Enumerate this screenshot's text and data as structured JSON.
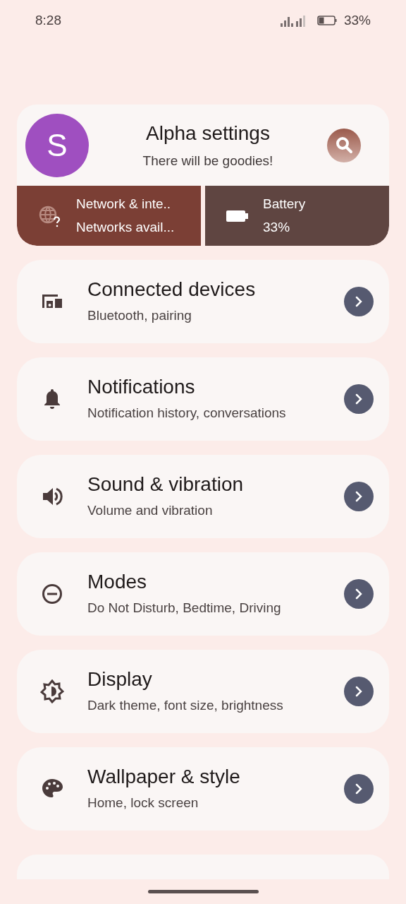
{
  "status_bar": {
    "time": "8:28",
    "battery": "33%"
  },
  "header": {
    "avatar": "S",
    "title": "Alpha settings",
    "subtitle": "There will be goodies!"
  },
  "tiles": [
    {
      "kind": "network",
      "title": "Network & inte..",
      "subtitle": "Networks avail..."
    },
    {
      "kind": "battery",
      "title": "Battery",
      "subtitle": "33%"
    }
  ],
  "items": [
    {
      "kind": "devices",
      "title": "Connected devices",
      "subtitle": "Bluetooth, pairing"
    },
    {
      "kind": "notifications",
      "title": "Notifications",
      "subtitle": "Notification history, conversations"
    },
    {
      "kind": "sound",
      "title": "Sound & vibration",
      "subtitle": "Volume and vibration"
    },
    {
      "kind": "modes",
      "title": "Modes",
      "subtitle": "Do Not Disturb, Bedtime, Driving"
    },
    {
      "kind": "display",
      "title": "Display",
      "subtitle": "Dark theme, font size, brightness"
    },
    {
      "kind": "wallpaper",
      "title": "Wallpaper & style",
      "subtitle": "Home, lock screen"
    }
  ]
}
